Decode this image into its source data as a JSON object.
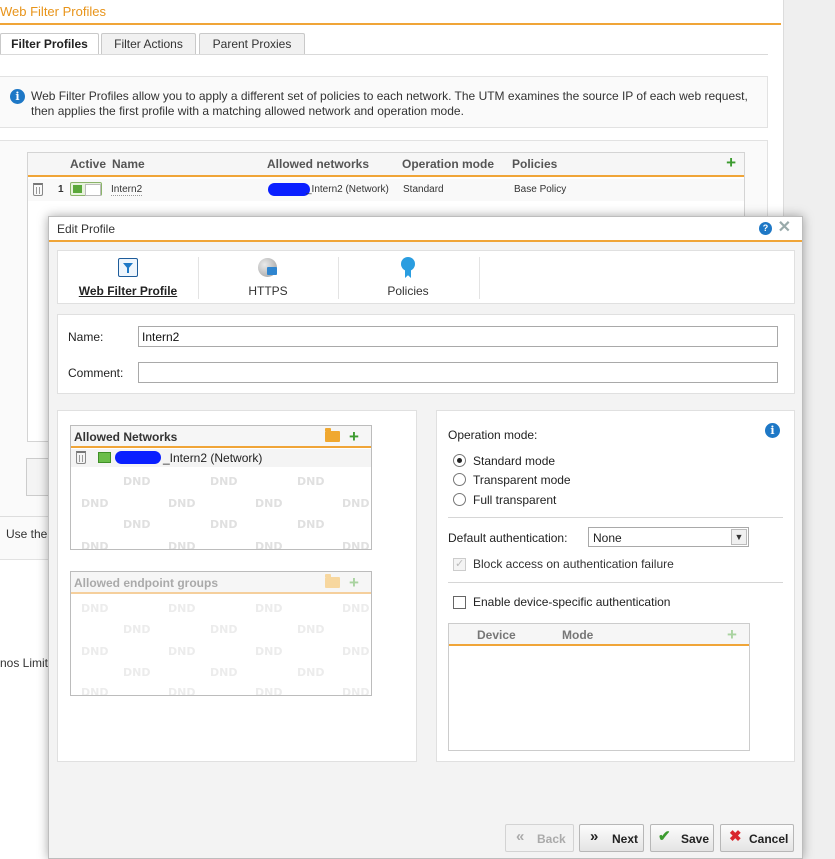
{
  "page": {
    "title": "Web Filter Profiles",
    "tabs": [
      "Filter Profiles",
      "Filter Actions",
      "Parent Proxies"
    ],
    "info_text": "Web Filter Profiles allow you to apply a different set of policies to each network. The UTM examines the source IP of each web request, then applies the first profile with a matching allowed network and operation mode.",
    "grid": {
      "headers": {
        "active": "Active",
        "name": "Name",
        "allowed_networks": "Allowed networks",
        "operation_mode": "Operation mode",
        "policies": "Policies"
      },
      "rows": [
        {
          "index": "1",
          "name": "Intern2",
          "network": "_Intern2 (Network)",
          "mode": "Standard",
          "policy": "Base Policy"
        }
      ]
    },
    "use_text": "Use the",
    "limit_text": "nos Limit"
  },
  "dialog": {
    "title": "Edit Profile",
    "tabs": [
      "Web Filter Profile",
      "HTTPS",
      "Policies"
    ],
    "name_label": "Name:",
    "name_value": "Intern2",
    "comment_label": "Comment:",
    "comment_value": "",
    "allowed_networks": {
      "title": "Allowed Networks",
      "item": "_Intern2 (Network)",
      "dnd": "DND"
    },
    "endpoint_groups": {
      "title": "Allowed endpoint groups"
    },
    "operation_mode": {
      "label": "Operation mode:",
      "options": [
        "Standard mode",
        "Transparent mode",
        "Full transparent"
      ],
      "selected": "Standard mode"
    },
    "default_auth": {
      "label": "Default authentication:",
      "value": "None"
    },
    "block_access_label": "Block access on authentication failure",
    "device_auth_label": "Enable device-specific authentication",
    "device_table": {
      "device": "Device",
      "mode": "Mode"
    },
    "buttons": {
      "back": "Back",
      "next": "Next",
      "save": "Save",
      "cancel": "Cancel"
    }
  },
  "colors": {
    "accent": "#f0a538",
    "title": "#e8941a",
    "info": "#1e78c6",
    "add": "#3c9b2f",
    "cancel": "#d9262d"
  }
}
